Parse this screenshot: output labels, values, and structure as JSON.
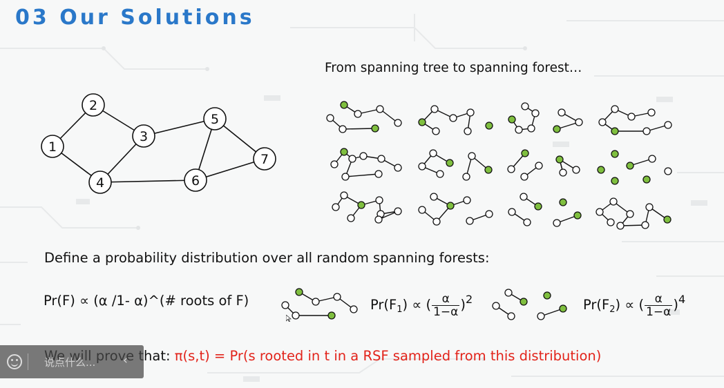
{
  "slide": {
    "title": "03 Our Solutions",
    "caption": "From spanning tree to spanning forest…",
    "define_text": "Define a probability distribution over all random spanning forests:",
    "formula_main": "Pr(F) ∝ (α /1- α)^(# roots of F)",
    "formula_f1": {
      "lhs": "Pr(F",
      "sub": "1",
      "mid": ") ∝ (",
      "num": "α",
      "den": "1−α",
      "close": ")",
      "exp": "2"
    },
    "formula_f2": {
      "lhs": "Pr(F",
      "sub": "2",
      "mid": ") ∝ (",
      "num": "α",
      "den": "1−α",
      "close": ")",
      "exp": "4"
    },
    "prove_black": "We will prove that: ",
    "prove_red": "π(s,t) = Pr(s rooted in t in a RSF sampled from this distribution)"
  },
  "graph": {
    "node_labels": [
      "1",
      "2",
      "3",
      "4",
      "5",
      "6",
      "7"
    ]
  },
  "overlay": {
    "placeholder": "说点什么...",
    "chevron": "‹",
    "smile_icon": "smile-icon"
  },
  "colors": {
    "title": "#2a78c9",
    "root_node": "#7fbf3f",
    "highlight_text": "#e2231a"
  }
}
